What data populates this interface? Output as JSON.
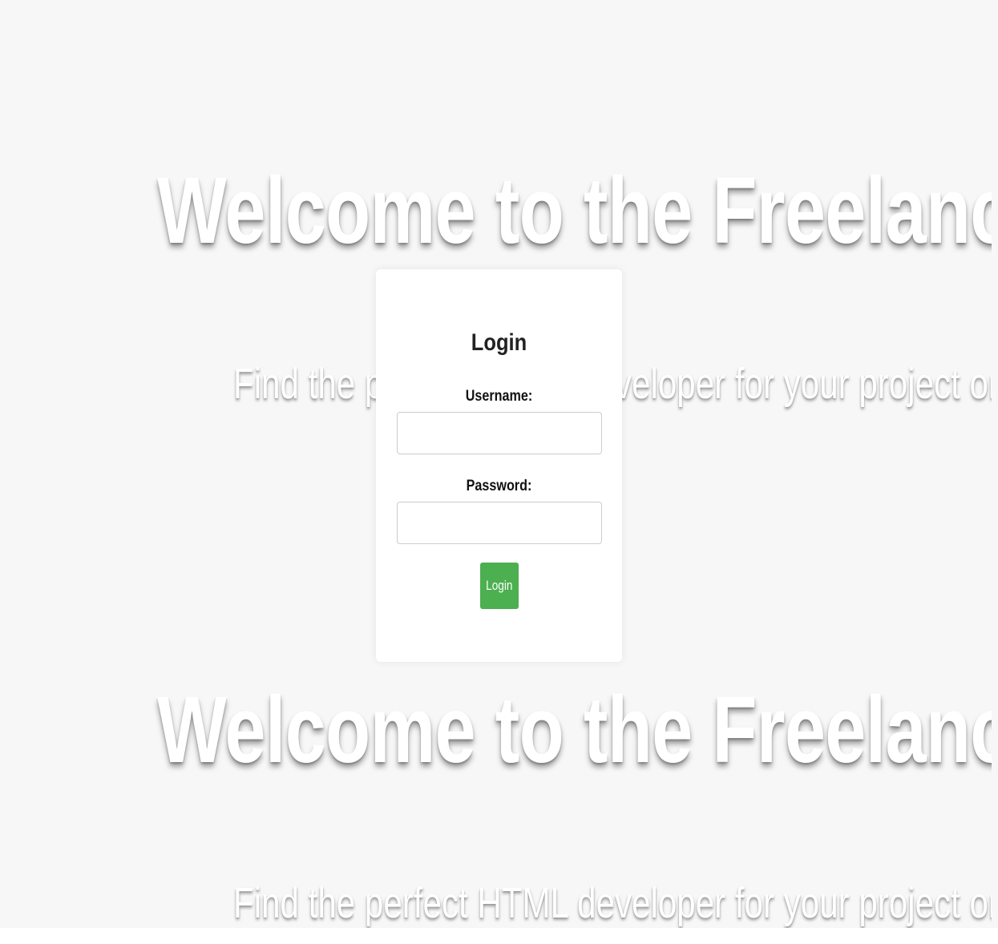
{
  "hero": {
    "title": "Welcome to the Freelancer",
    "subtitle": "Find the perfect HTML developer for your project or start"
  },
  "login": {
    "heading": "Login",
    "username_label": "Username:",
    "username_value": "",
    "password_label": "Password:",
    "password_value": "",
    "button_label": "Login"
  },
  "colors": {
    "background": "#f7f7f7",
    "card": "#ffffff",
    "button": "#4caf50",
    "hero_text": "#ffffff"
  }
}
